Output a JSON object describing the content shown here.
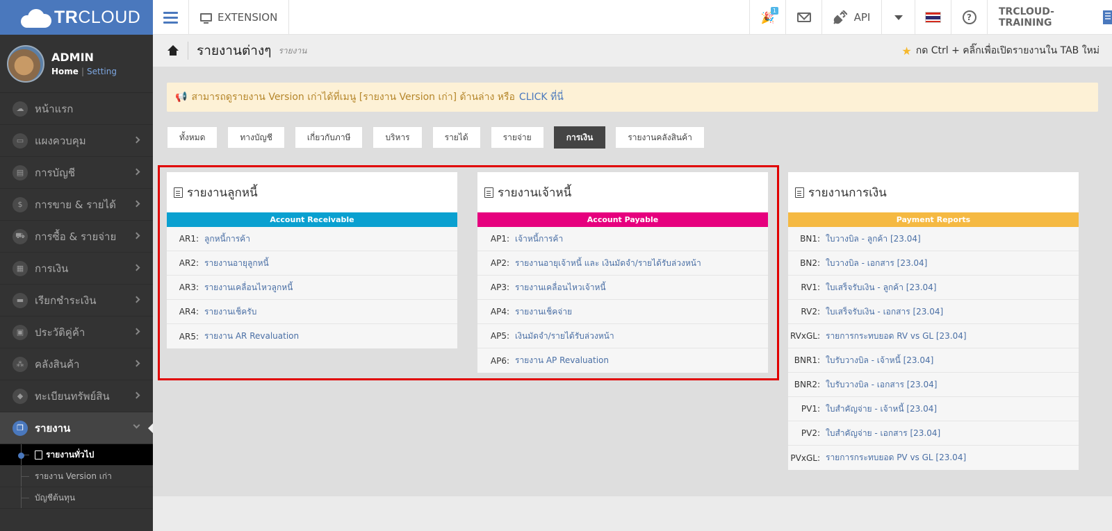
{
  "brand": {
    "logo_bold": "TR",
    "logo_light": "CLOUD"
  },
  "topbar": {
    "extension_label": "EXTENSION",
    "notif_badge": "1",
    "api_label": "API",
    "user_label": "TRCLOUD-TRAINING",
    "help_glyph": "?"
  },
  "profile": {
    "name": "ADMIN",
    "home": "Home",
    "separator": "|",
    "setting": "Setting"
  },
  "sidebar": {
    "items": [
      {
        "label": "หน้าแรก",
        "icon": "cloud-icon",
        "glyph": "☁"
      },
      {
        "label": "แผงควบคุม",
        "icon": "monitor-icon",
        "glyph": "▭"
      },
      {
        "label": "การบัญชี",
        "icon": "book-icon",
        "glyph": "▤"
      },
      {
        "label": "การขาย & รายได้",
        "icon": "dollar-icon",
        "glyph": "$"
      },
      {
        "label": "การซื้อ & รายจ่าย",
        "icon": "cart-icon",
        "glyph": "⛟"
      },
      {
        "label": "การเงิน",
        "icon": "calendar-icon",
        "glyph": "▦"
      },
      {
        "label": "เรียกชำระเงิน",
        "icon": "card-icon",
        "glyph": "▬"
      },
      {
        "label": "ประวัติคู่ค้า",
        "icon": "contact-icon",
        "glyph": "▣"
      },
      {
        "label": "คลังสินค้า",
        "icon": "boxes-icon",
        "glyph": "⁂"
      },
      {
        "label": "ทะเบียนทรัพย์สิน",
        "icon": "gem-icon",
        "glyph": "◆"
      },
      {
        "label": "รายงาน",
        "icon": "report-icon",
        "glyph": "❐"
      }
    ],
    "subitems": [
      {
        "label": "รายงานทั่วไป"
      },
      {
        "label": "รายงาน Version เก่า"
      },
      {
        "label": "บัญชีต้นทุน"
      }
    ]
  },
  "breadcrumb": {
    "title": "รายงานต่างๆ",
    "subtitle": "รายงาน",
    "hint": "กด Ctrl + คลิ๊กเพื่อเปิดรายงานใน TAB ใหม่"
  },
  "notice": {
    "text": "สามารถดูรายงาน Version เก่าได้ที่เมนู [รายงาน Version เก่า] ด้านล่าง หรือ",
    "link": "CLICK ที่นี่"
  },
  "tabs": [
    "ทั้งหมด",
    "ทางบัญชี",
    "เกี่ยวกับภาษี",
    "บริหาร",
    "รายได้",
    "รายจ่าย",
    "การเงิน",
    "รายงานคลังสินค้า"
  ],
  "panels": [
    {
      "title": "รายงานลูกหนี้",
      "header": "Account Receivable",
      "color": "#0aa0d0",
      "rows": [
        {
          "code": "AR1:",
          "label": "ลูกหนี้การค้า"
        },
        {
          "code": "AR2:",
          "label": "รายงานอายุลูกหนี้"
        },
        {
          "code": "AR3:",
          "label": "รายงานเคลื่อนไหวลูกหนี้"
        },
        {
          "code": "AR4:",
          "label": "รายงานเช็ครับ"
        },
        {
          "code": "AR5:",
          "label": "รายงาน AR Revaluation"
        }
      ]
    },
    {
      "title": "รายงานเจ้าหนี้",
      "header": "Account Payable",
      "color": "#e6007e",
      "rows": [
        {
          "code": "AP1:",
          "label": "เจ้าหนี้การค้า"
        },
        {
          "code": "AP2:",
          "label": "รายงานอายุเจ้าหนี้ และ เงินมัดจำ/รายได้รับล่วงหน้า"
        },
        {
          "code": "AP3:",
          "label": "รายงานเคลื่อนไหวเจ้าหนี้"
        },
        {
          "code": "AP4:",
          "label": "รายงานเช็คจ่าย"
        },
        {
          "code": "AP5:",
          "label": "เงินมัดจำ/รายได้รับล่วงหน้า"
        },
        {
          "code": "AP6:",
          "label": "รายงาน AP Revaluation"
        }
      ]
    },
    {
      "title": "รายงานการเงิน",
      "header": "Payment Reports",
      "color": "#f5b942",
      "rows": [
        {
          "code": "BN1:",
          "label": "ใบวางบิล - ลูกค้า [23.04]"
        },
        {
          "code": "BN2:",
          "label": "ใบวางบิล - เอกสาร [23.04]"
        },
        {
          "code": "RV1:",
          "label": "ใบเสร็จรับเงิน - ลูกค้า [23.04]"
        },
        {
          "code": "RV2:",
          "label": "ใบเสร็จรับเงิน - เอกสาร [23.04]"
        },
        {
          "code": "RVxGL:",
          "label": "รายการกระทบยอด RV vs GL [23.04]"
        },
        {
          "code": "BNR1:",
          "label": "ใบรับวางบิล - เจ้าหนี้ [23.04]"
        },
        {
          "code": "BNR2:",
          "label": "ใบรับวางบิล - เอกสาร [23.04]"
        },
        {
          "code": "PV1:",
          "label": "ใบสำคัญจ่าย - เจ้าหนี้ [23.04]"
        },
        {
          "code": "PV2:",
          "label": "ใบสำคัญจ่าย - เอกสาร [23.04]"
        },
        {
          "code": "PVxGL:",
          "label": "รายการกระทบยอด PV vs GL [23.04]"
        }
      ]
    }
  ]
}
